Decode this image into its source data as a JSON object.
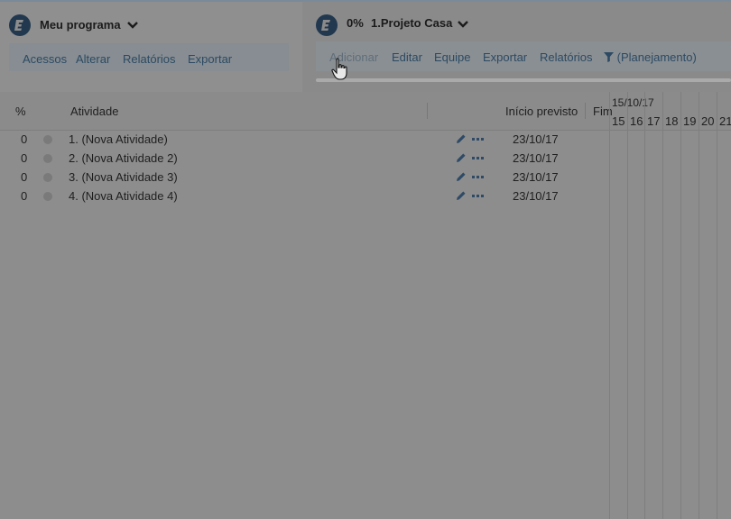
{
  "program": {
    "title": "Meu programa",
    "menu": [
      "Acessos",
      "Alterar",
      "Relatórios",
      "Exportar"
    ]
  },
  "project": {
    "percent": "0%",
    "name": "1.Projeto Casa",
    "menu": [
      "Adicionar",
      "Editar",
      "Equipe",
      "Exportar",
      "Relatórios"
    ],
    "filter_label": "(Planejamento)"
  },
  "columns": {
    "percent": "%",
    "activity": "Atividade",
    "start": "Início previsto",
    "end": "Fim"
  },
  "rows": [
    {
      "percent": "0",
      "name": "1. (Nova Atividade)",
      "start": "23/10/17"
    },
    {
      "percent": "0",
      "name": "2. (Nova Atividade 2)",
      "start": "23/10/17"
    },
    {
      "percent": "0",
      "name": "3. (Nova Atividade 3)",
      "start": "23/10/17"
    },
    {
      "percent": "0",
      "name": "4. (Nova Atividade 4)",
      "start": "23/10/17"
    }
  ],
  "gantt": {
    "week_start": "15/10/17",
    "days": [
      "15",
      "16",
      "17",
      "18",
      "19",
      "20",
      "21"
    ]
  },
  "colors": {
    "logo": "#21384f",
    "menu_text": "#2c4a63",
    "icon": "#2e4a66"
  }
}
